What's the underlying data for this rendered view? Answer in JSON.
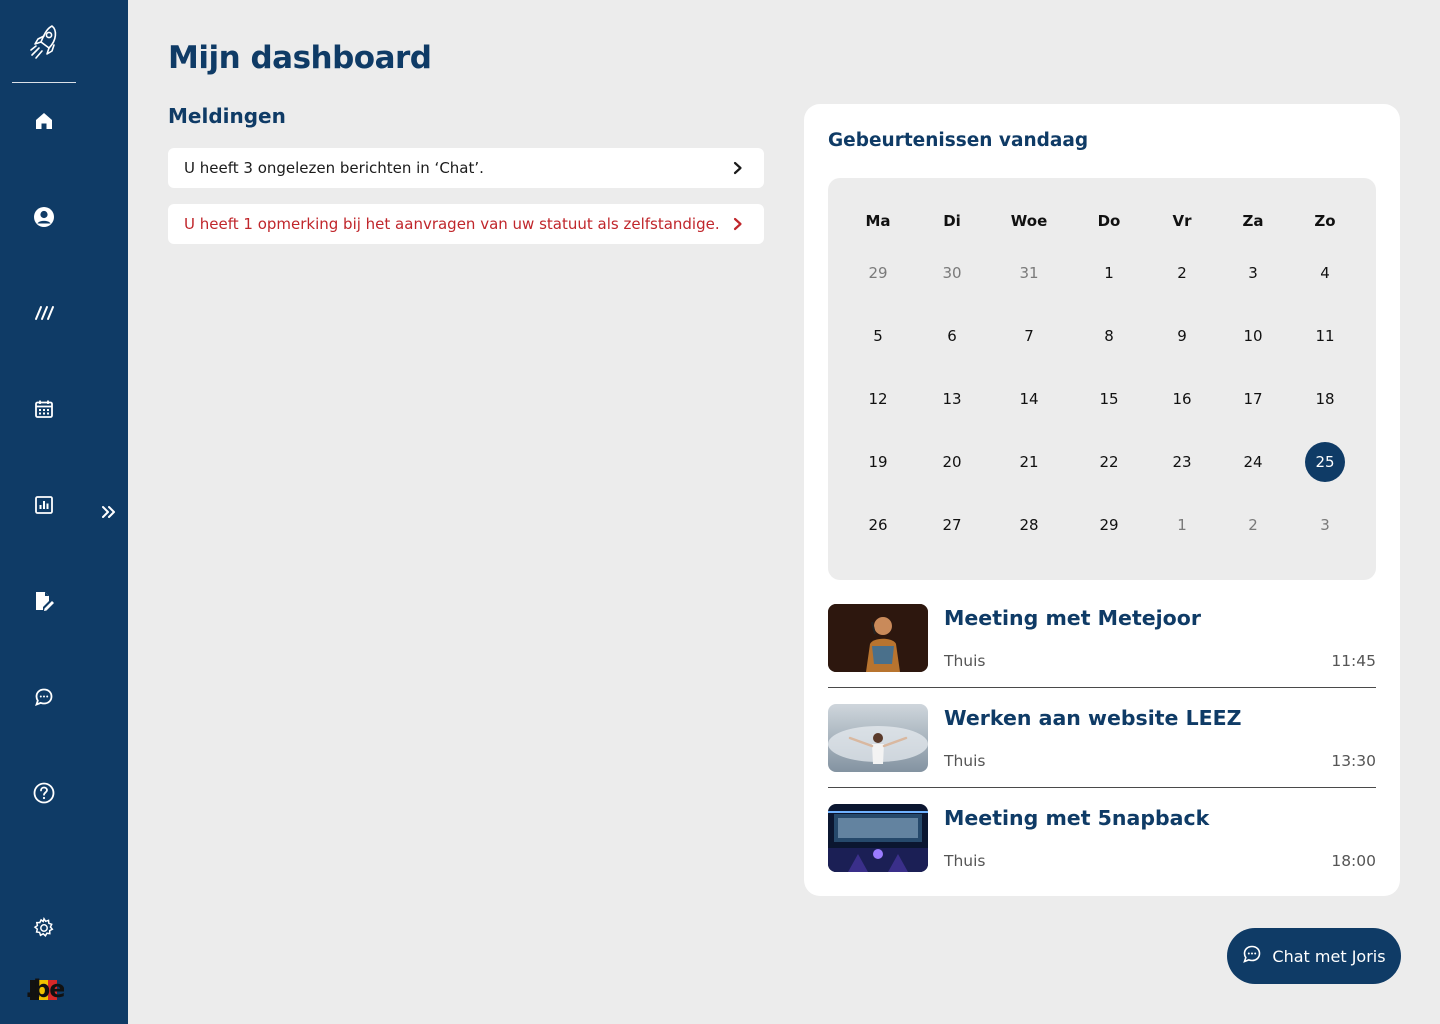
{
  "page": {
    "title": "Mijn dashboard"
  },
  "notifications": {
    "title": "Meldingen",
    "items": [
      {
        "text": "U heeft 3 ongelezen berichten in ‘Chat’.",
        "color": "#1b1b1b"
      },
      {
        "text": "U heeft 1 opmerking bij het aanvragen van uw statuut als zelfstandige.",
        "color": "#c0262b"
      }
    ]
  },
  "sidebar": {
    "items": [
      {
        "icon": "home-icon"
      },
      {
        "icon": "user-icon"
      },
      {
        "icon": "slashes-icon"
      },
      {
        "icon": "calendar-icon"
      },
      {
        "icon": "chart-icon"
      },
      {
        "icon": "document-edit-icon"
      },
      {
        "icon": "chat-icon"
      },
      {
        "icon": "help-icon"
      },
      {
        "icon": "settings-icon"
      }
    ],
    "brand_logo": ".be"
  },
  "events": {
    "title": "Gebeurtenissen vandaag",
    "calendar": {
      "weekdays": [
        "Ma",
        "Di",
        "Woe",
        "Do",
        "Vr",
        "Za",
        "Zo"
      ],
      "weeks": [
        [
          "29",
          "30",
          "31",
          "1",
          "2",
          "3",
          "4"
        ],
        [
          "5",
          "6",
          "7",
          "8",
          "9",
          "10",
          "11"
        ],
        [
          "12",
          "13",
          "14",
          "15",
          "16",
          "17",
          "18"
        ],
        [
          "19",
          "20",
          "21",
          "22",
          "23",
          "24",
          "25"
        ],
        [
          "26",
          "27",
          "28",
          "29",
          "1",
          "2",
          "3"
        ]
      ],
      "today": "25"
    },
    "items": [
      {
        "title": "Meeting met Metejoor",
        "place": "Thuis",
        "time": "11:45"
      },
      {
        "title": "Werken aan website LEEZ",
        "place": "Thuis",
        "time": "13:30"
      },
      {
        "title": "Meeting met 5napback",
        "place": "Thuis",
        "time": "18:00"
      }
    ]
  },
  "chat_button": {
    "label": "Chat met Joris"
  },
  "colors": {
    "primary": "#0f3b66",
    "background": "#ececec",
    "alert": "#c0262b"
  }
}
